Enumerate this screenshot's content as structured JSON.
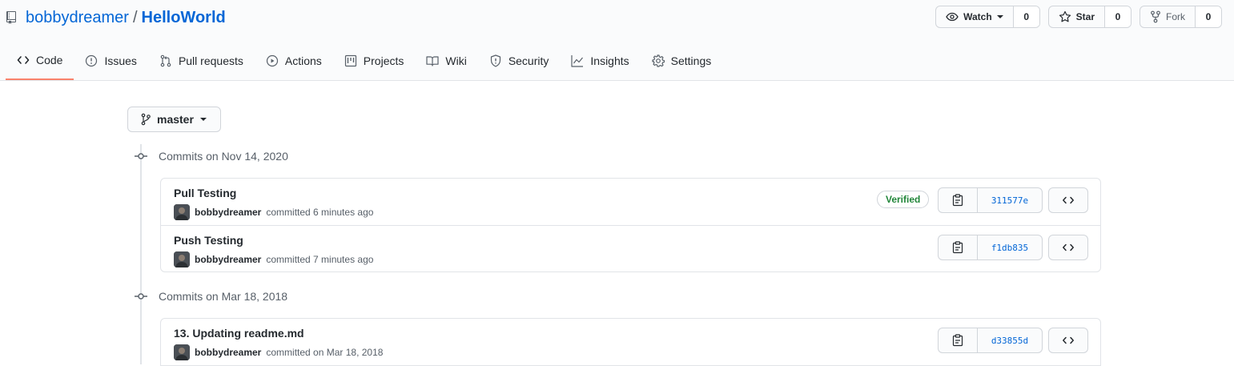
{
  "repo": {
    "owner": "bobbydreamer",
    "separator": "/",
    "name": "HelloWorld"
  },
  "actions": {
    "watch": {
      "label": "Watch",
      "count": "0"
    },
    "star": {
      "label": "Star",
      "count": "0"
    },
    "fork": {
      "label": "Fork",
      "count": "0"
    }
  },
  "nav": {
    "code": "Code",
    "issues": "Issues",
    "pull_requests": "Pull requests",
    "actions": "Actions",
    "projects": "Projects",
    "wiki": "Wiki",
    "security": "Security",
    "insights": "Insights",
    "settings": "Settings"
  },
  "branch": {
    "name": "master"
  },
  "groups": [
    {
      "title": "Commits on Nov 14, 2020",
      "commits": [
        {
          "message": "Pull Testing",
          "author": "bobbydreamer",
          "time": "committed 6 minutes ago",
          "verified": "Verified",
          "sha": "311577e"
        },
        {
          "message": "Push Testing",
          "author": "bobbydreamer",
          "time": "committed 7 minutes ago",
          "sha": "f1db835"
        }
      ]
    },
    {
      "title": "Commits on Mar 18, 2018",
      "commits": [
        {
          "message": "13. Updating readme.md",
          "author": "bobbydreamer",
          "time": "committed on Mar 18, 2018",
          "sha": "d33855d"
        }
      ]
    }
  ],
  "colors": {
    "link": "#0366d6",
    "nav_underline": "#f9826c",
    "verified": "#22863a"
  }
}
